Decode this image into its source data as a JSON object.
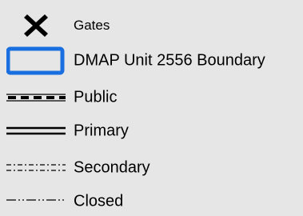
{
  "legend": {
    "items": [
      {
        "symbol": "x-cross-icon",
        "label": "Gates"
      },
      {
        "symbol": "boundary-box-icon",
        "label": "DMAP Unit  2556 Boundary",
        "color": "#1a6fe0"
      },
      {
        "symbol": "public-road-line-icon",
        "label": "Public"
      },
      {
        "symbol": "primary-road-line-icon",
        "label": "Primary"
      },
      {
        "symbol": "secondary-road-line-icon",
        "label": "Secondary"
      },
      {
        "symbol": "closed-road-line-icon",
        "label": "Closed"
      }
    ]
  }
}
